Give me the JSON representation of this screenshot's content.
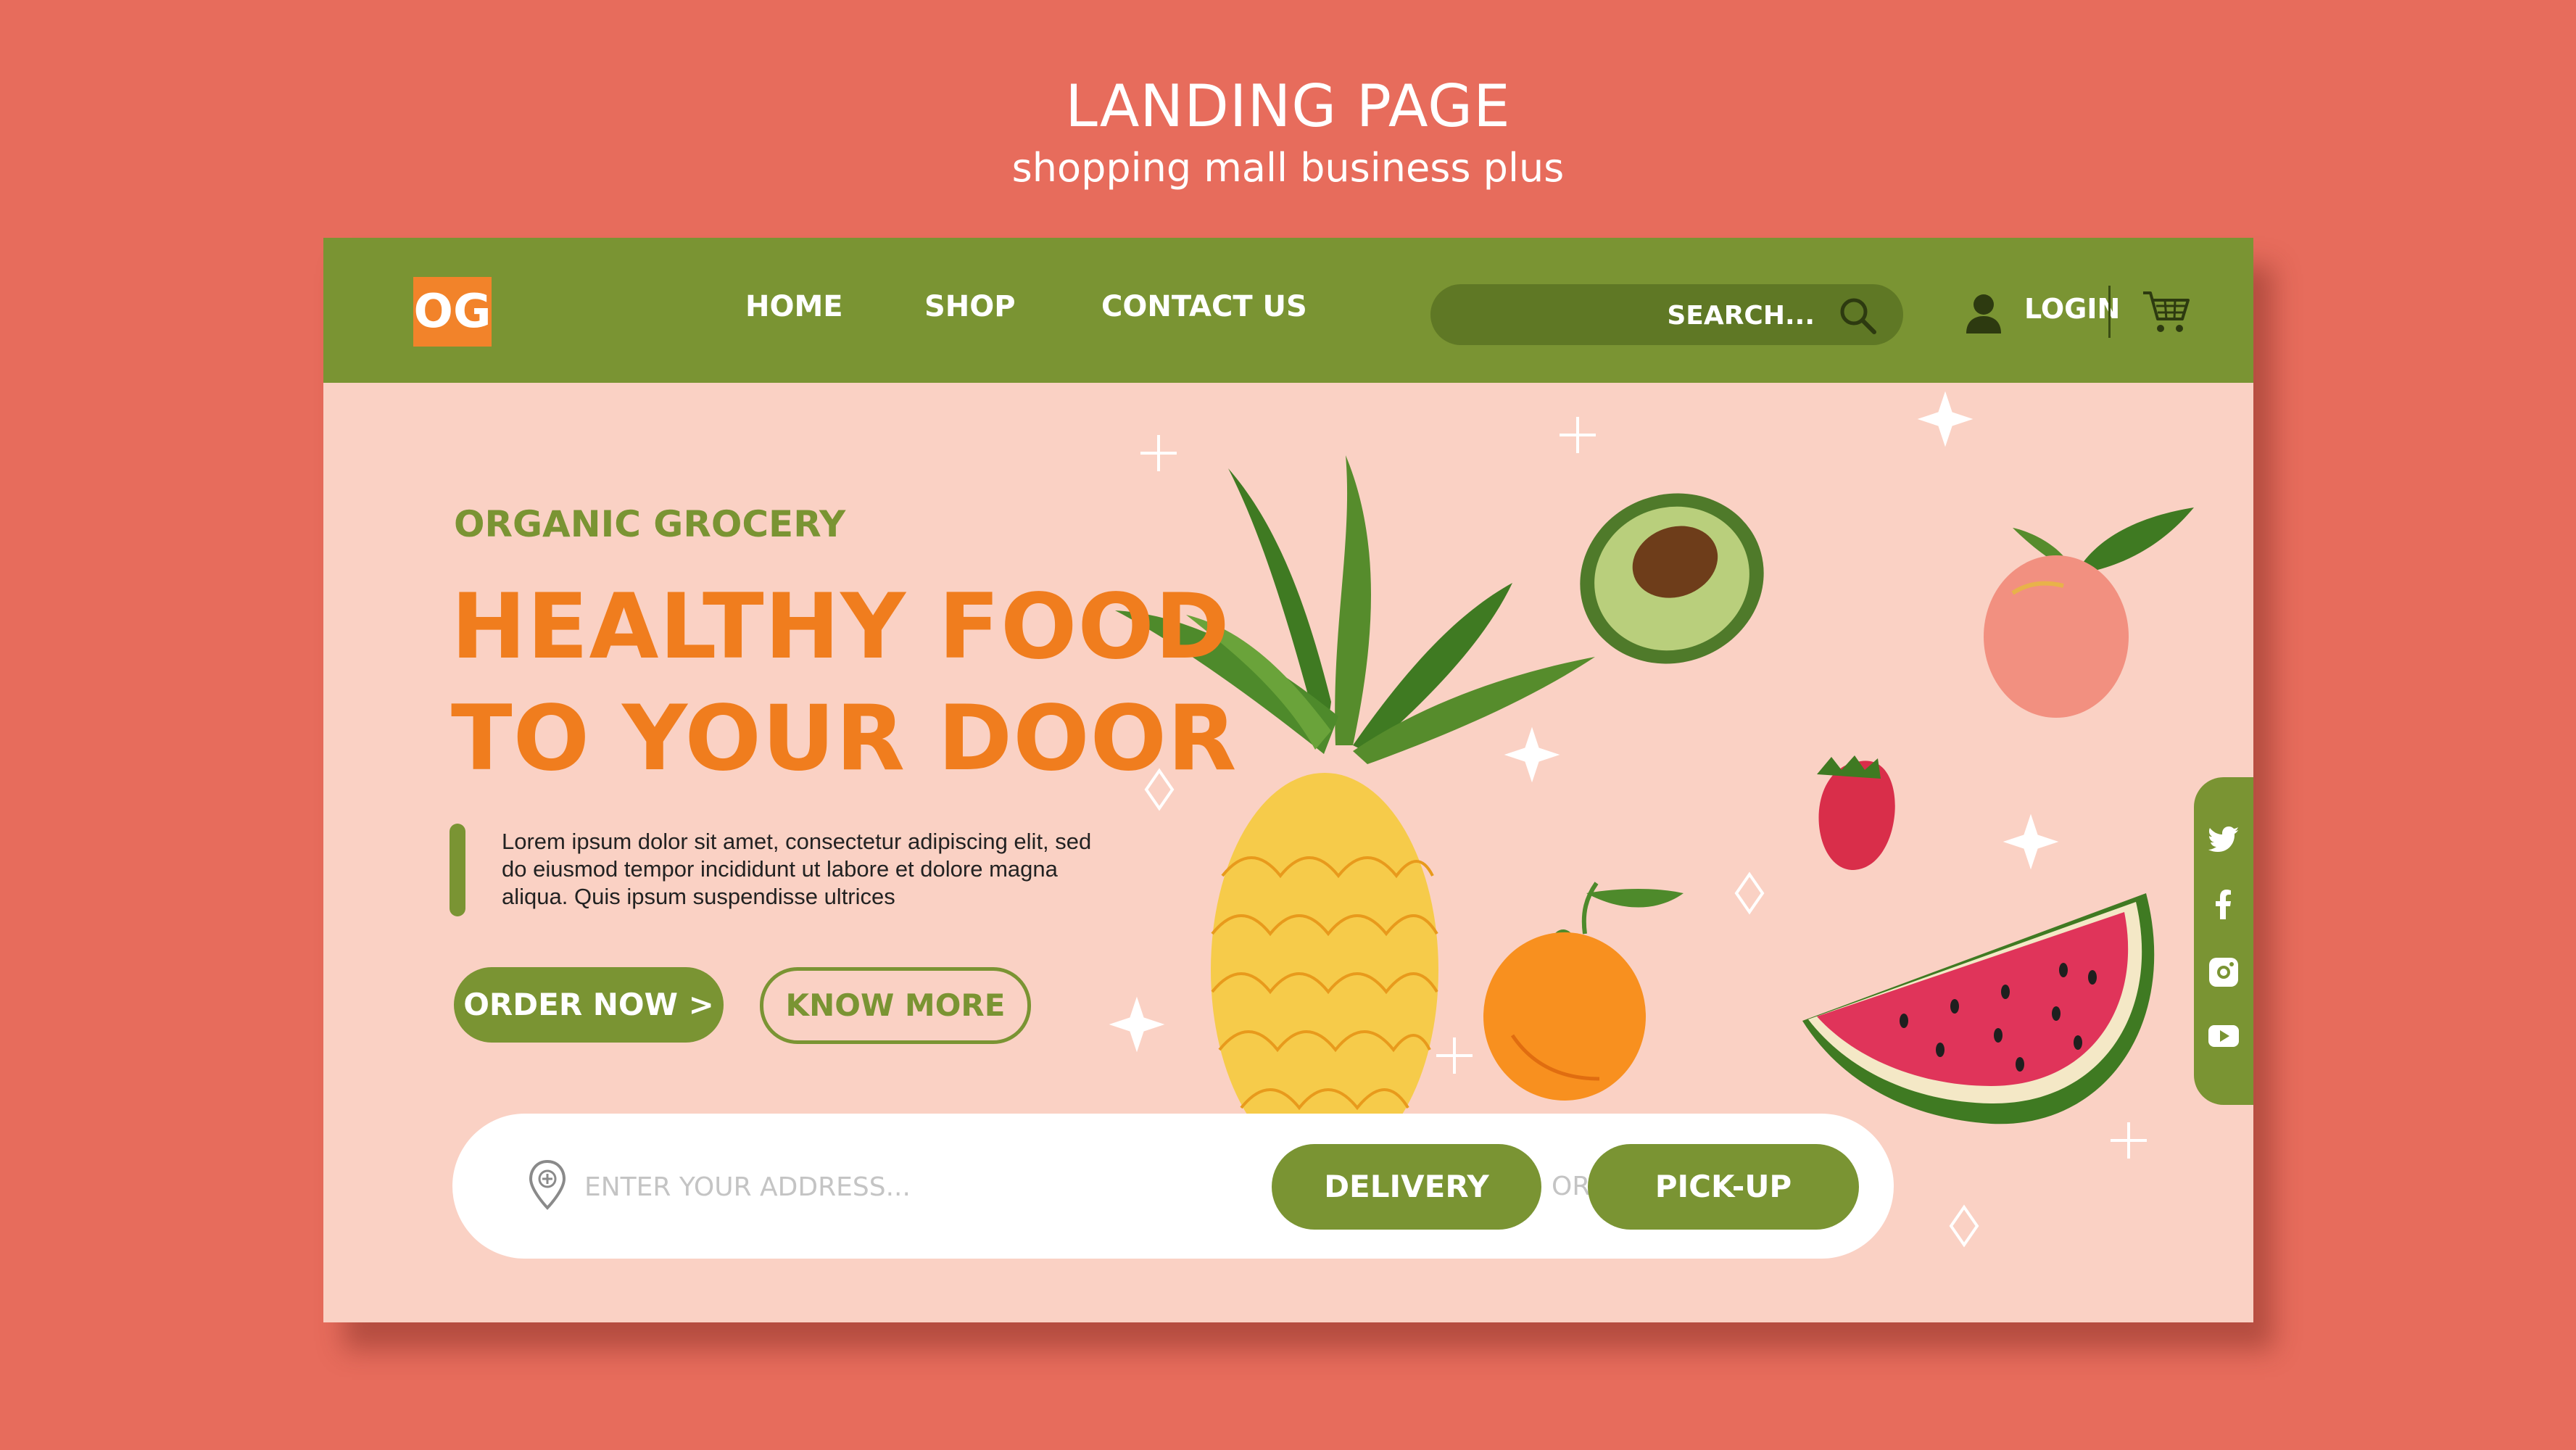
{
  "page": {
    "title": "LANDING PAGE",
    "subtitle": "shopping mall business plus"
  },
  "nav": {
    "logo": "OG",
    "links": [
      "HOME",
      "SHOP",
      "CONTACT US"
    ],
    "search_placeholder": "SEARCH...",
    "login": "LOGIN"
  },
  "hero": {
    "eyebrow": "ORGANIC GROCERY",
    "title": "HEALTHY FOOD\nTO YOUR DOOR",
    "body": "Lorem ipsum dolor sit amet, consectetur adipiscing elit, sed do eiusmod tempor incididunt ut labore et dolore magna aliqua. Quis ipsum suspendisse ultrices",
    "order_button": "ORDER NOW >",
    "know_button": "KNOW MORE"
  },
  "address": {
    "placeholder": "ENTER YOUR ADDRESS...",
    "delivery_button": "DELIVERY",
    "or_text": "OR",
    "pickup_button": "PICK-UP"
  },
  "social": [
    "twitter-icon",
    "facebook-icon",
    "instagram-icon",
    "youtube-icon"
  ],
  "colors": {
    "background": "#e76c5c",
    "nav": "#7a9433",
    "hero_bg": "#fad1c4",
    "accent_orange": "#f07d1e",
    "logo_bg": "#f2832a"
  }
}
